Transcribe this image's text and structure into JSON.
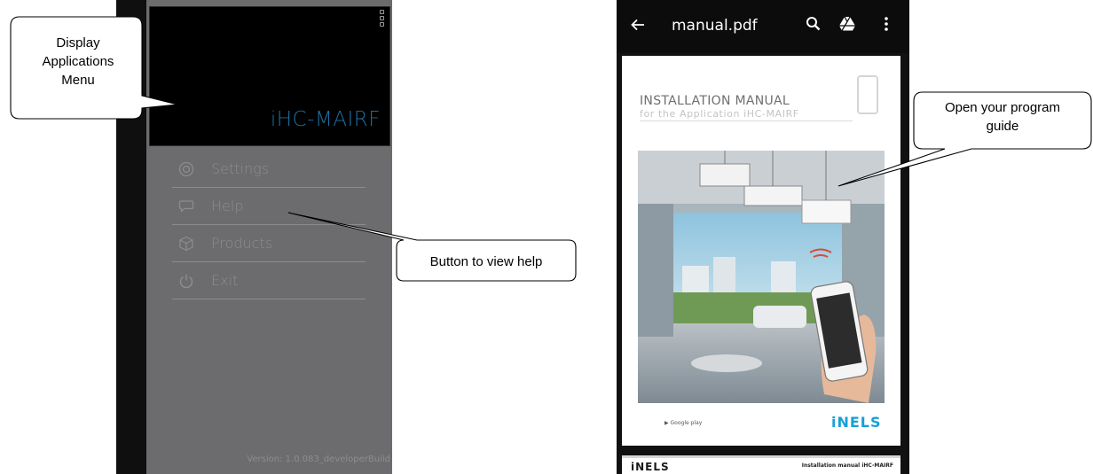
{
  "left_screen": {
    "app_title": "iHC-MAIRF",
    "menu": [
      {
        "label": "Settings",
        "icon": "settings-icon"
      },
      {
        "label": "Help",
        "icon": "help-icon"
      },
      {
        "label": "Products",
        "icon": "products-icon"
      },
      {
        "label": "Exit",
        "icon": "power-icon"
      }
    ],
    "version": "Version: 1.0.083_developerBuild"
  },
  "callouts": {
    "display_apps_menu": [
      "Display",
      "Applications",
      "Menu"
    ],
    "help_button": "Button to view help",
    "program_guide": [
      "Open your program",
      "guide"
    ]
  },
  "right_screen": {
    "file_name": "manual.pdf",
    "toolbar_icons": [
      "back-arrow-icon",
      "search-icon",
      "drive-icon",
      "more-icon"
    ],
    "pdf_title": "INSTALLATION MANUAL",
    "pdf_subtitle": "for the Application iHC-MAIRF",
    "footer_store": "▶ Google play",
    "footer_logo": "iNELS",
    "next_page_logo": "iNELS",
    "next_page_title": "Installation manual iHC-MAIRF"
  },
  "colors": {
    "drawer_bg": "#6c6c6e",
    "title_blue": "#1d6fa0",
    "inels_blue": "#16a0d8"
  }
}
